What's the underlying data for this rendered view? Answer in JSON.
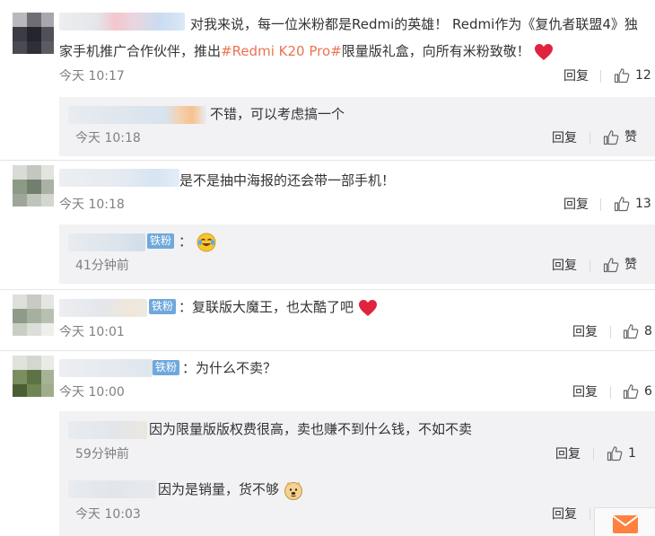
{
  "comments": [
    {
      "text_line1": "对我来说，每一位米粉都是Redmi的英雄！ Redmi作为《复仇者联盟4》独",
      "text_line2_a": "家手机推广合作伙伴，推出",
      "text_line2_link": "#Redmi K20 Pro#",
      "text_line2_b": "限量版礼盒，向所有米粉致敬！",
      "time": "今天 10:17",
      "reply": "回复",
      "likes": "12",
      "replies": [
        {
          "text": "不错，可以考虑搞一个",
          "time": "今天 10:18",
          "reply": "回复",
          "likes": "赞"
        }
      ]
    },
    {
      "text": "是不是抽中海报的还会带一部手机！",
      "time": "今天 10:18",
      "reply": "回复",
      "likes": "13",
      "replies": [
        {
          "badge": "铁粉",
          "text": "：",
          "time": "41分钟前",
          "reply": "回复",
          "likes": "赞"
        }
      ]
    },
    {
      "badge": "铁粉",
      "text": "：复联版大魔王，也太酷了吧",
      "time": "今天 10:01",
      "reply": "回复",
      "likes": "8"
    },
    {
      "badge": "铁粉",
      "text": "：为什么不卖？",
      "time": "今天 10:00",
      "reply": "回复",
      "likes": "6",
      "replies": [
        {
          "text": "因为限量版版权费很高，卖也赚不到什么钱，不如不卖",
          "time": "59分钟前",
          "reply": "回复",
          "likes": "1"
        },
        {
          "text": "因为是销量，货不够",
          "time": "今天 10:03",
          "reply": "回复"
        }
      ]
    }
  ],
  "colors": {
    "accent": "#eb7350",
    "badge": "#6fa8dc",
    "sub_bg": "#f2f2f5"
  }
}
